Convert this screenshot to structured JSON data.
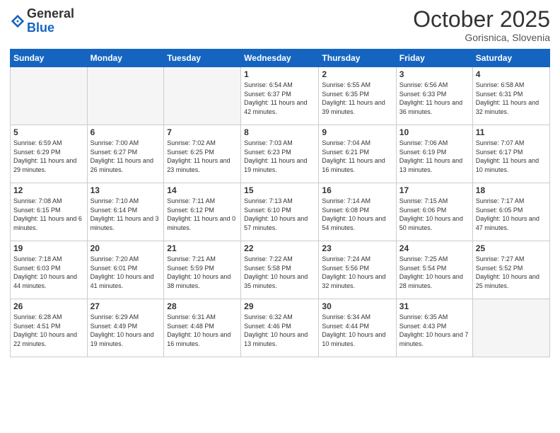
{
  "header": {
    "logo_general": "General",
    "logo_blue": "Blue",
    "month_title": "October 2025",
    "location": "Gorisnica, Slovenia"
  },
  "weekdays": [
    "Sunday",
    "Monday",
    "Tuesday",
    "Wednesday",
    "Thursday",
    "Friday",
    "Saturday"
  ],
  "weeks": [
    [
      {
        "day": "",
        "info": ""
      },
      {
        "day": "",
        "info": ""
      },
      {
        "day": "",
        "info": ""
      },
      {
        "day": "1",
        "info": "Sunrise: 6:54 AM\nSunset: 6:37 PM\nDaylight: 11 hours\nand 42 minutes."
      },
      {
        "day": "2",
        "info": "Sunrise: 6:55 AM\nSunset: 6:35 PM\nDaylight: 11 hours\nand 39 minutes."
      },
      {
        "day": "3",
        "info": "Sunrise: 6:56 AM\nSunset: 6:33 PM\nDaylight: 11 hours\nand 36 minutes."
      },
      {
        "day": "4",
        "info": "Sunrise: 6:58 AM\nSunset: 6:31 PM\nDaylight: 11 hours\nand 32 minutes."
      }
    ],
    [
      {
        "day": "5",
        "info": "Sunrise: 6:59 AM\nSunset: 6:29 PM\nDaylight: 11 hours\nand 29 minutes."
      },
      {
        "day": "6",
        "info": "Sunrise: 7:00 AM\nSunset: 6:27 PM\nDaylight: 11 hours\nand 26 minutes."
      },
      {
        "day": "7",
        "info": "Sunrise: 7:02 AM\nSunset: 6:25 PM\nDaylight: 11 hours\nand 23 minutes."
      },
      {
        "day": "8",
        "info": "Sunrise: 7:03 AM\nSunset: 6:23 PM\nDaylight: 11 hours\nand 19 minutes."
      },
      {
        "day": "9",
        "info": "Sunrise: 7:04 AM\nSunset: 6:21 PM\nDaylight: 11 hours\nand 16 minutes."
      },
      {
        "day": "10",
        "info": "Sunrise: 7:06 AM\nSunset: 6:19 PM\nDaylight: 11 hours\nand 13 minutes."
      },
      {
        "day": "11",
        "info": "Sunrise: 7:07 AM\nSunset: 6:17 PM\nDaylight: 11 hours\nand 10 minutes."
      }
    ],
    [
      {
        "day": "12",
        "info": "Sunrise: 7:08 AM\nSunset: 6:15 PM\nDaylight: 11 hours\nand 6 minutes."
      },
      {
        "day": "13",
        "info": "Sunrise: 7:10 AM\nSunset: 6:14 PM\nDaylight: 11 hours\nand 3 minutes."
      },
      {
        "day": "14",
        "info": "Sunrise: 7:11 AM\nSunset: 6:12 PM\nDaylight: 11 hours\nand 0 minutes."
      },
      {
        "day": "15",
        "info": "Sunrise: 7:13 AM\nSunset: 6:10 PM\nDaylight: 10 hours\nand 57 minutes."
      },
      {
        "day": "16",
        "info": "Sunrise: 7:14 AM\nSunset: 6:08 PM\nDaylight: 10 hours\nand 54 minutes."
      },
      {
        "day": "17",
        "info": "Sunrise: 7:15 AM\nSunset: 6:06 PM\nDaylight: 10 hours\nand 50 minutes."
      },
      {
        "day": "18",
        "info": "Sunrise: 7:17 AM\nSunset: 6:05 PM\nDaylight: 10 hours\nand 47 minutes."
      }
    ],
    [
      {
        "day": "19",
        "info": "Sunrise: 7:18 AM\nSunset: 6:03 PM\nDaylight: 10 hours\nand 44 minutes."
      },
      {
        "day": "20",
        "info": "Sunrise: 7:20 AM\nSunset: 6:01 PM\nDaylight: 10 hours\nand 41 minutes."
      },
      {
        "day": "21",
        "info": "Sunrise: 7:21 AM\nSunset: 5:59 PM\nDaylight: 10 hours\nand 38 minutes."
      },
      {
        "day": "22",
        "info": "Sunrise: 7:22 AM\nSunset: 5:58 PM\nDaylight: 10 hours\nand 35 minutes."
      },
      {
        "day": "23",
        "info": "Sunrise: 7:24 AM\nSunset: 5:56 PM\nDaylight: 10 hours\nand 32 minutes."
      },
      {
        "day": "24",
        "info": "Sunrise: 7:25 AM\nSunset: 5:54 PM\nDaylight: 10 hours\nand 28 minutes."
      },
      {
        "day": "25",
        "info": "Sunrise: 7:27 AM\nSunset: 5:52 PM\nDaylight: 10 hours\nand 25 minutes."
      }
    ],
    [
      {
        "day": "26",
        "info": "Sunrise: 6:28 AM\nSunset: 4:51 PM\nDaylight: 10 hours\nand 22 minutes."
      },
      {
        "day": "27",
        "info": "Sunrise: 6:29 AM\nSunset: 4:49 PM\nDaylight: 10 hours\nand 19 minutes."
      },
      {
        "day": "28",
        "info": "Sunrise: 6:31 AM\nSunset: 4:48 PM\nDaylight: 10 hours\nand 16 minutes."
      },
      {
        "day": "29",
        "info": "Sunrise: 6:32 AM\nSunset: 4:46 PM\nDaylight: 10 hours\nand 13 minutes."
      },
      {
        "day": "30",
        "info": "Sunrise: 6:34 AM\nSunset: 4:44 PM\nDaylight: 10 hours\nand 10 minutes."
      },
      {
        "day": "31",
        "info": "Sunrise: 6:35 AM\nSunset: 4:43 PM\nDaylight: 10 hours\nand 7 minutes."
      },
      {
        "day": "",
        "info": ""
      }
    ]
  ]
}
